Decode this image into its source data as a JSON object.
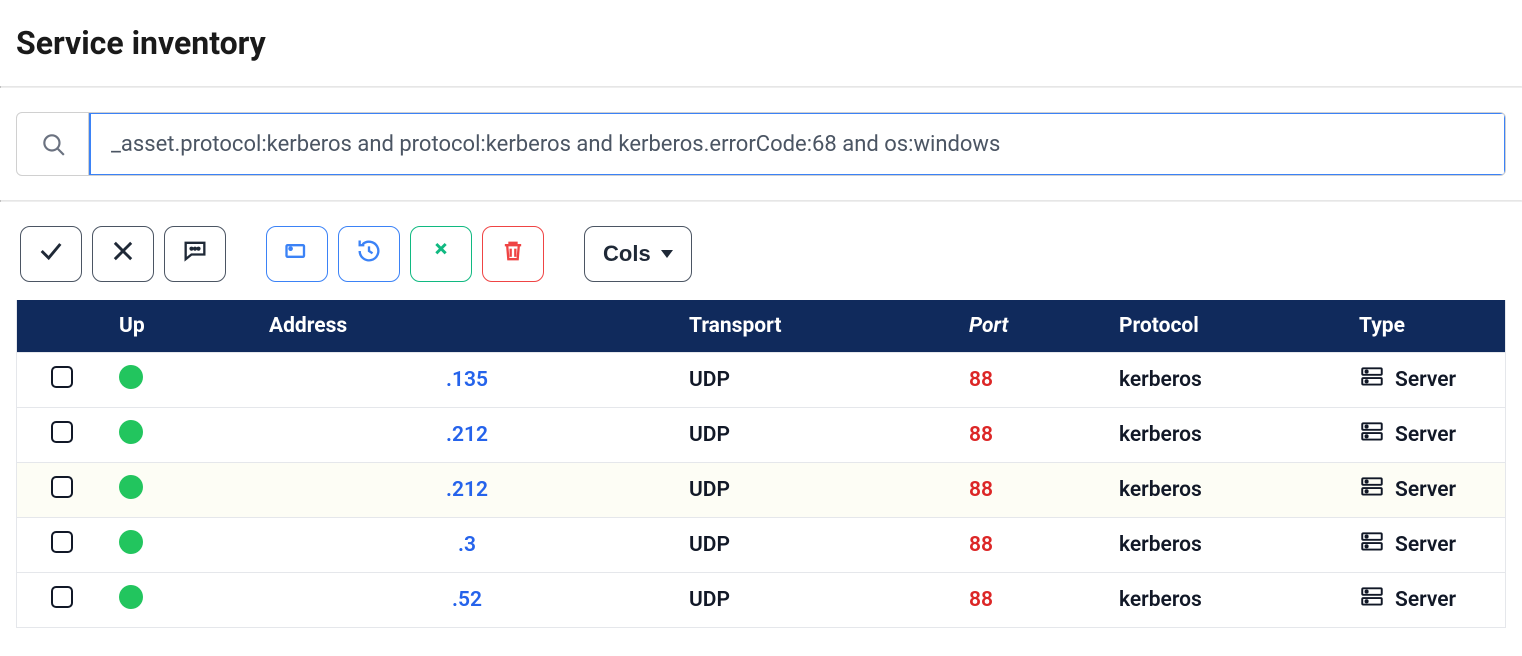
{
  "page": {
    "title": "Service inventory"
  },
  "search": {
    "value": "_asset.protocol:kerberos and protocol:kerberos and kerberos.errorCode:68 and os:windows"
  },
  "toolbar": {
    "cols_label": "Cols"
  },
  "table": {
    "headers": {
      "up": "Up",
      "address": "Address",
      "transport": "Transport",
      "port": "Port",
      "protocol": "Protocol",
      "type": "Type"
    },
    "rows": [
      {
        "address": ".135",
        "transport": "UDP",
        "port": "88",
        "protocol": "kerberos",
        "type": "Server"
      },
      {
        "address": ".212",
        "transport": "UDP",
        "port": "88",
        "protocol": "kerberos",
        "type": "Server"
      },
      {
        "address": ".212",
        "transport": "UDP",
        "port": "88",
        "protocol": "kerberos",
        "type": "Server"
      },
      {
        "address": ".3",
        "transport": "UDP",
        "port": "88",
        "protocol": "kerberos",
        "type": "Server"
      },
      {
        "address": ".52",
        "transport": "UDP",
        "port": "88",
        "protocol": "kerberos",
        "type": "Server"
      }
    ]
  }
}
